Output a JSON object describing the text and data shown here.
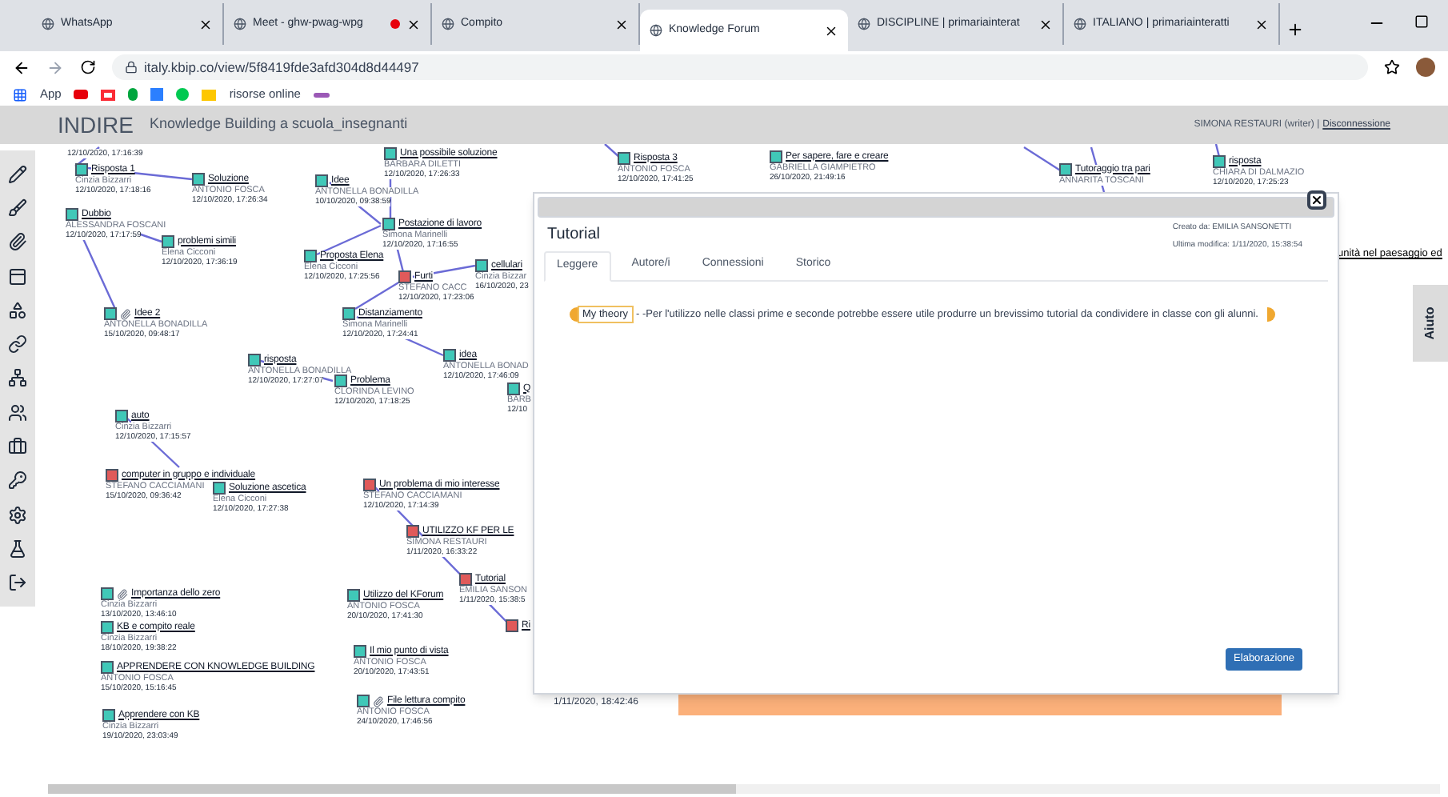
{
  "browser": {
    "tabs": [
      {
        "title": "WhatsApp",
        "selected": false,
        "recording": false
      },
      {
        "title": "Meet - ghw-pwag-wpg",
        "selected": false,
        "recording": true
      },
      {
        "title": "Compito",
        "selected": false,
        "recording": false
      },
      {
        "title": "Knowledge Forum",
        "selected": true,
        "recording": false
      },
      {
        "title": "DISCIPLINE | primariainterat",
        "selected": false,
        "recording": false
      },
      {
        "title": "ITALIANO | primariainteratti",
        "selected": false,
        "recording": false
      }
    ],
    "address": "italy.kbip.co/view/5f8419fde3afd304d8d44497",
    "bookmarks": [
      {
        "label": "App"
      },
      {
        "label": "risorse online"
      }
    ]
  },
  "header": {
    "brand": "INDIRE",
    "subtitle": "Knowledge Building a scuola_insegnanti",
    "user": "SIMONA RESTAURI (writer) |",
    "logout": "Disconnessione"
  },
  "notes": [
    {
      "date": "12/10/2020, 17:16:39"
    },
    {
      "title": "Risposta 1",
      "author": "Cinzia Bizzarri",
      "date": "12/10/2020, 17:18:16",
      "color": "#40c8b8",
      "attachment": false
    },
    {
      "title": "Soluzione",
      "author": "ANTONIO FOSCA",
      "date": "12/10/2020, 17:26:34",
      "color": "#40c8b8",
      "attachment": false
    },
    {
      "title": "Dubbio",
      "author": "ALESSANDRA FOSCANI",
      "date": "12/10/2020, 17:17:59",
      "color": "#40c8b8",
      "attachment": false
    },
    {
      "title": "problemi simili",
      "author": "Elena Cicconi",
      "date": "12/10/2020, 17:36:19",
      "color": "#40c8b8",
      "attachment": false
    },
    {
      "title": "Idee 2",
      "author": "ANTONELLA BONADILLA",
      "date": "15/10/2020, 09:48:17",
      "color": "#40c8b8",
      "attachment": true
    },
    {
      "title": "auto",
      "author": "Cinzia Bizzarri",
      "date": "12/10/2020, 17:15:57",
      "color": "#40c8b8",
      "attachment": false
    },
    {
      "title": "Una possibile soluzione",
      "author": "BARBARA DILETTI",
      "date": "12/10/2020, 17:26:33",
      "color": "#40c8b8",
      "attachment": false
    },
    {
      "title": "Idee",
      "author": "ANTONELLA BONADILLA",
      "date": "10/10/2020, 09:38:59",
      "color": "#40c8b8",
      "attachment": false
    },
    {
      "title": "Postazione di lavoro",
      "author": "Simona Marinelli",
      "date": "12/10/2020, 17:16:55",
      "color": "#40c8b8",
      "attachment": false
    },
    {
      "title": "Proposta Elena",
      "author": "Elena Cicconi",
      "date": "12/10/2020, 17:25:56",
      "color": "#40c8b8",
      "attachment": false
    },
    {
      "title": "Furti",
      "author": "STEFANO CACC",
      "date": "12/10/2020, 17:23:06",
      "color": "#e05a5a",
      "attachment": false
    },
    {
      "title": "cellulari",
      "author": "Cinzia Bizzar",
      "date": "16/10/2020, 23",
      "color": "#40c8b8",
      "attachment": false
    },
    {
      "title": "Distanziamento",
      "author": "Simona Marinelli",
      "date": "12/10/2020, 17:24:41",
      "color": "#40c8b8",
      "attachment": false
    },
    {
      "title": "risposta",
      "author": "ANTONELLA BONADILLA",
      "date": "12/10/2020, 17:27:07",
      "color": "#40c8b8",
      "attachment": false
    },
    {
      "title": "idea",
      "author": "ANTONELLA BONAD",
      "date": "12/10/2020, 17:46:09",
      "color": "#40c8b8",
      "attachment": false
    },
    {
      "title": "Problema",
      "author": "CLORINDA LEVINO",
      "date": "12/10/2020, 17:18:25",
      "color": "#40c8b8",
      "attachment": false
    },
    {
      "title": "Q",
      "author": "BARB",
      "date": "12/10",
      "color": "#40c8b8",
      "attachment": false
    },
    {
      "title": "computer in gruppo e individuale",
      "author": "STEFANO CACCIAMANI",
      "date": "15/10/2020, 09:36:42",
      "color": "#e05a5a",
      "attachment": false
    },
    {
      "title": "Soluzione ascetica",
      "author": "Elena Cicconi",
      "date": "12/10/2020, 17:27:38",
      "color": "#40c8b8",
      "attachment": false
    },
    {
      "title": "Un problema di mio interesse",
      "author": "STEFANO CACCIAMANI",
      "date": "12/10/2020, 17:14:39",
      "color": "#e05a5a",
      "attachment": false
    },
    {
      "title": "UTILIZZO KF PER LE",
      "author": "SIMONA RESTAURI",
      "date": "1/11/2020, 16:33:22",
      "color": "#e05a5a",
      "attachment": false
    },
    {
      "title": "Tutorial",
      "author": "EMILIA SANSON",
      "date": "1/11/2020, 15:38:5",
      "color": "#e05a5a",
      "attachment": false
    },
    {
      "title": "Ri",
      "color": "#e05a5a",
      "attachment": false
    },
    {
      "title": "Importanza dello zero",
      "author": "Cinzia Bizzarri",
      "date": "13/10/2020, 13:46:10",
      "color": "#40c8b8",
      "attachment": true
    },
    {
      "title": "KB e compito reale",
      "author": "Cinzia Bizzarri",
      "date": "18/10/2020, 19:38:22",
      "color": "#40c8b8",
      "attachment": false
    },
    {
      "title": "APPRENDERE CON KNOWLEDGE BUILDING",
      "author": "ANTONIO FOSCA",
      "date": "15/10/2020, 15:16:45",
      "color": "#40c8b8",
      "attachment": false
    },
    {
      "title": "Apprendere con KB",
      "author": "Cinzia Bizzarri",
      "date": "19/10/2020, 23:03:49",
      "color": "#40c8b8",
      "attachment": false
    },
    {
      "title": "Utilizzo del KForum",
      "author": "ANTONIO FOSCA",
      "date": "20/10/2020, 17:41:30",
      "color": "#40c8b8",
      "attachment": false
    },
    {
      "title": "Il mio punto di vista",
      "author": "ANTONIO FOSCA",
      "date": "20/10/2020, 17:43:51",
      "color": "#40c8b8",
      "attachment": false
    },
    {
      "title": "File lettura compito",
      "author": "ANTONIO FOSCA",
      "date": "24/10/2020, 17:46:56",
      "color": "#40c8b8",
      "attachment": true
    },
    {
      "title": "Risposta 3",
      "author": "ANTONIO FOSCA",
      "date": "12/10/2020, 17:41:25",
      "color": "#40c8b8",
      "attachment": false
    },
    {
      "title": "Per sapere, fare e creare",
      "author": "GABRIELLA GIAMPIETRO",
      "date": "26/10/2020, 21:49:16",
      "color": "#40c8b8",
      "attachment": false
    },
    {
      "title": "Tutoraggio tra pari",
      "author": "ANNARITA TOSCANI",
      "color": "#40c8b8",
      "attachment": false
    },
    {
      "title": "risposta",
      "author": "CHIARA DI DALMAZIO",
      "date": "12/10/2020, 17:25:23",
      "color": "#40c8b8",
      "attachment": false
    }
  ],
  "side_link": "unità nel paesaggio ed",
  "stray_date": "1/11/2020, 18:42:46",
  "help_tab": "Aiuto",
  "dialog": {
    "title": "Tutorial",
    "created": "Creato da: EMILIA SANSONETTI",
    "modified": "Ultima modifica: 1/11/2020, 15:38:54",
    "tabs": [
      {
        "label": "Leggere",
        "selected": true
      },
      {
        "label": "Autore/i",
        "selected": false
      },
      {
        "label": "Connessioni",
        "selected": false
      },
      {
        "label": "Storico",
        "selected": false
      }
    ],
    "scaffold": "My theory",
    "body": " -  -Per l'utilizzo nelle classi prime  e seconde potrebbe essere utile produrre un brevissimo tutorial da condividere in classe con gli alunni.",
    "button": "Elaborazione"
  }
}
